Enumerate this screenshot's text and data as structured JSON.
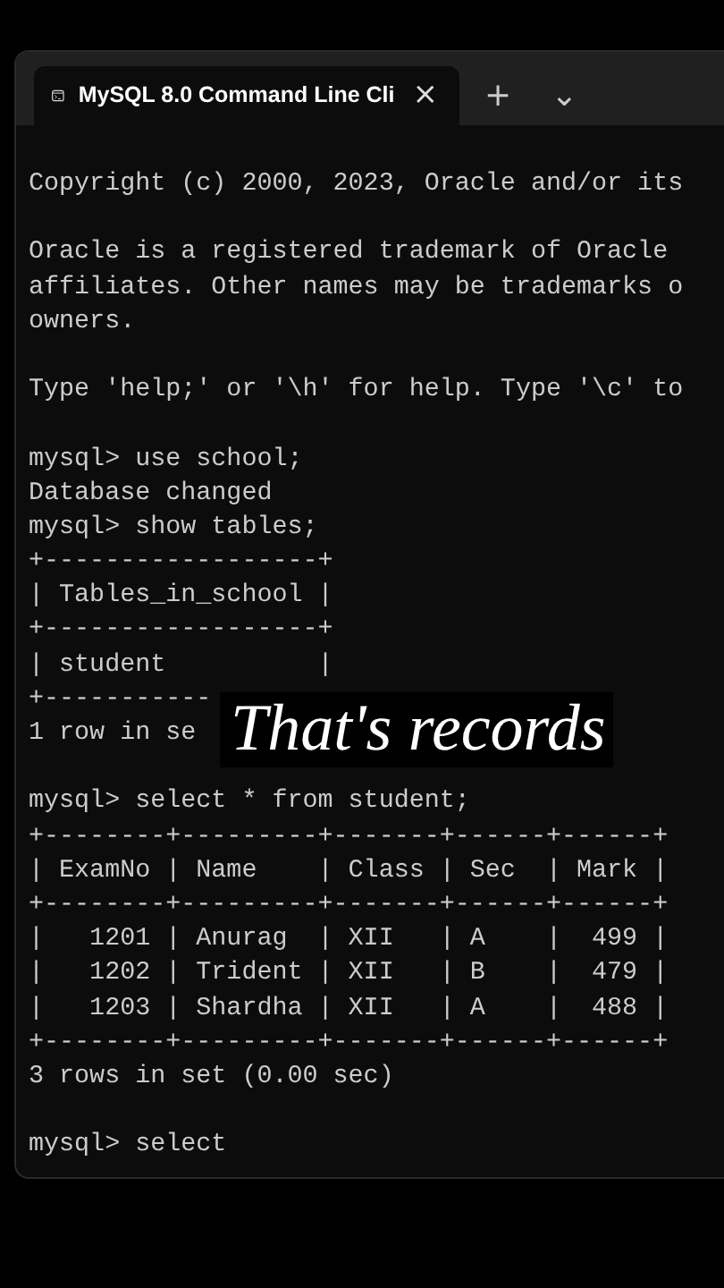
{
  "tab": {
    "title": "MySQL 8.0 Command Line Cli",
    "close": "×",
    "selected": true
  },
  "new_tab": "+",
  "dropdown": "⌄",
  "blocks": [
    [
      "Copyright (c) 2000, 2023, Oracle and/or its"
    ],
    [
      "Oracle is a registered trademark of Oracle",
      "affiliates. Other names may be trademarks o",
      "owners."
    ],
    [
      "Type 'help;' or '\\h' for help. Type '\\c' to"
    ],
    [
      "mysql> use school;",
      "Database changed",
      "mysql> show tables;",
      "+------------------+",
      "| Tables_in_school |",
      "+------------------+",
      "| student          |",
      "+-----------",
      "1 row in se"
    ],
    [
      "mysql> select * from student;",
      "+--------+---------+-------+------+------+",
      "| ExamNo | Name    | Class | Sec  | Mark |",
      "+--------+---------+-------+------+------+",
      "|   1201 | Anurag  | XII   | A    |  499 |",
      "|   1202 | Trident | XII   | B    |  479 |",
      "|   1203 | Shardha | XII   | A    |  488 |",
      "+--------+---------+-------+------+------+",
      "3 rows in set (0.00 sec)"
    ],
    [
      "mysql> select"
    ]
  ],
  "caption": "That's records"
}
